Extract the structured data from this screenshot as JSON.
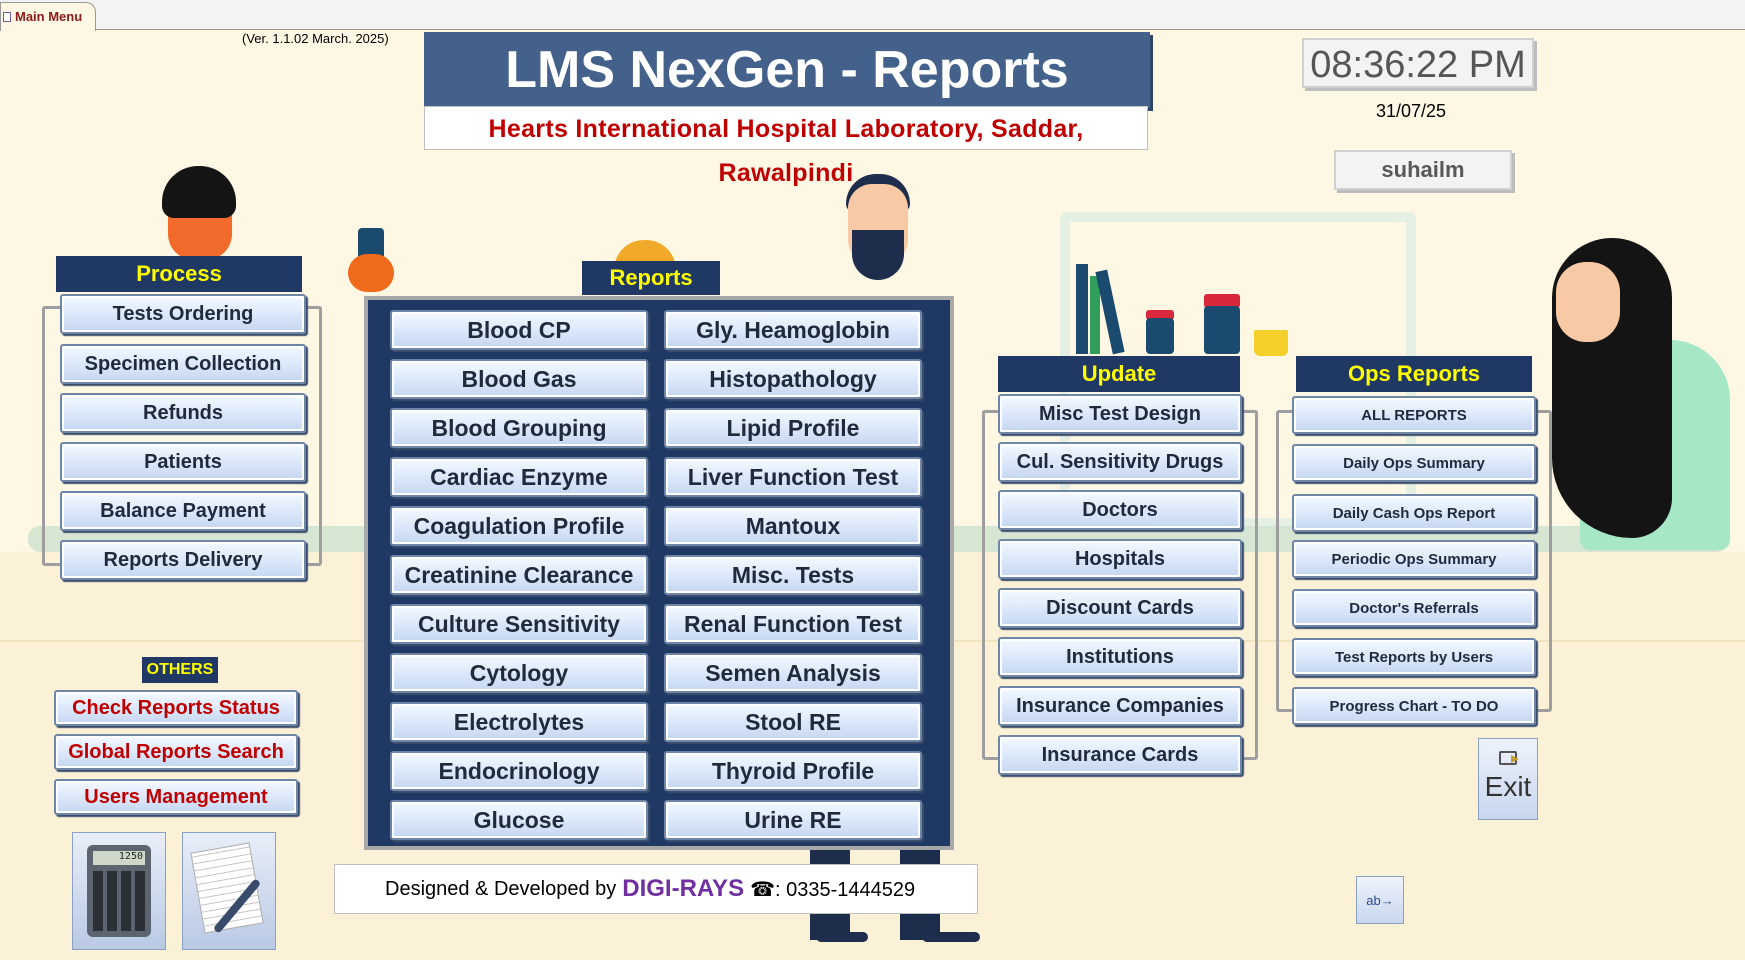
{
  "tab": {
    "title": "Main Menu"
  },
  "header": {
    "version": "(Ver. 1.1.02 March. 2025)",
    "title": "LMS NexGen - Reports",
    "subtitle": "Hearts International Hospital Laboratory, Saddar, Rawalpindi",
    "time": "08:36:22 PM",
    "date": "31/07/25",
    "user": "suhailm"
  },
  "process": {
    "title": "Process",
    "items": [
      "Tests Ordering",
      "Specimen Collection",
      "Refunds",
      "Patients",
      "Balance Payment",
      "Reports Delivery"
    ]
  },
  "reports": {
    "title": "Reports",
    "left": [
      "Blood CP",
      "Blood Gas",
      "Blood Grouping",
      "Cardiac Enzyme",
      "Coagulation Profile",
      "Creatinine Clearance",
      "Culture Sensitivity",
      "Cytology",
      "Electrolytes",
      "Endocrinology",
      "Glucose"
    ],
    "right": [
      "Gly. Heamoglobin",
      "Histopathology",
      "Lipid Profile",
      "Liver Function Test",
      "Mantoux",
      "Misc. Tests",
      "Renal Function Test",
      "Semen Analysis",
      "Stool RE",
      "Thyroid Profile",
      "Urine RE"
    ]
  },
  "update": {
    "title": "Update",
    "items": [
      "Misc Test Design",
      "Cul. Sensitivity Drugs",
      "Doctors",
      "Hospitals",
      "Discount Cards",
      "Institutions",
      "Insurance Companies",
      "Insurance Cards"
    ]
  },
  "ops": {
    "title": "Ops Reports",
    "items": [
      "ALL REPORTS",
      "Daily Ops Summary",
      "Daily Cash Ops Report",
      "Periodic Ops Summary",
      "Doctor's Referrals",
      "Test Reports by Users",
      "Progress Chart - TO DO"
    ]
  },
  "others": {
    "title": "OTHERS",
    "items": [
      "Check Reports Status",
      "Global Reports Search",
      "Users Management"
    ]
  },
  "tools": {
    "calc_display": "1250"
  },
  "footer": {
    "prefix": "Designed & Developed by",
    "brand": "DIGI-RAYS",
    "phone": "☎: 0335-1444529"
  },
  "exit": {
    "label": "Exit"
  },
  "colors": {
    "panel": "#1f3864",
    "header_text": "#ffff00",
    "title_bg": "#44618c",
    "subtitle": "#c00000"
  }
}
